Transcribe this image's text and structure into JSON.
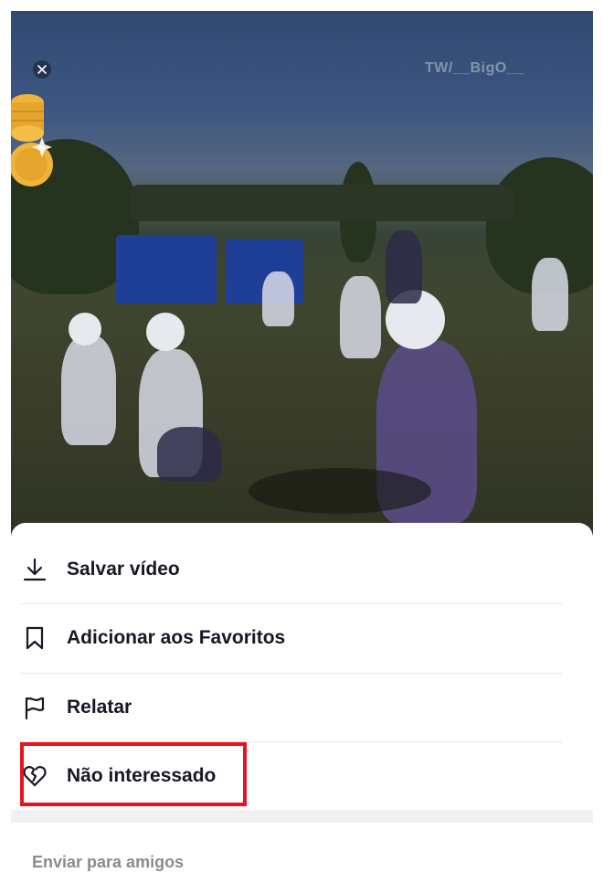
{
  "video": {
    "watermark": "TW/__BigO__",
    "close_icon": "close-icon",
    "coins_icon": "coin-stack-icon"
  },
  "menu": {
    "items": [
      {
        "label": "Salvar vídeo",
        "icon": "download-icon"
      },
      {
        "label": "Adicionar aos Favoritos",
        "icon": "bookmark-icon"
      },
      {
        "label": "Relatar",
        "icon": "flag-icon"
      },
      {
        "label": "Não interessado",
        "icon": "broken-heart-icon"
      }
    ]
  },
  "send_friends": {
    "label": "Enviar para amigos"
  },
  "colors": {
    "highlight": "#e8141b",
    "text_primary": "#161823",
    "text_secondary": "#8a8b91"
  }
}
